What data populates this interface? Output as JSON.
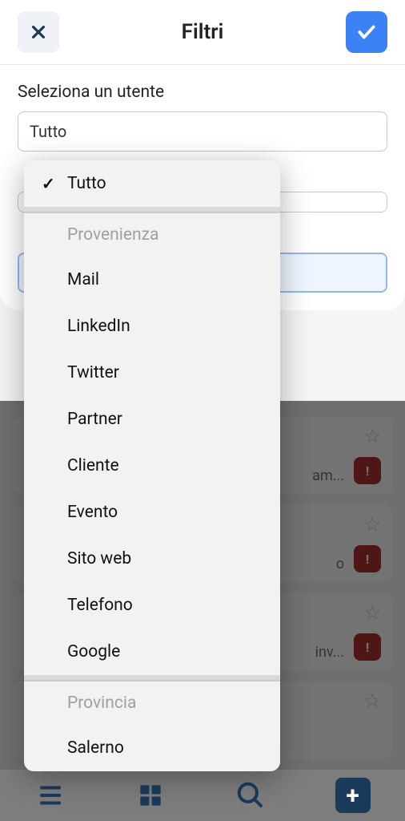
{
  "header": {
    "title": "Filtri"
  },
  "form": {
    "label_user": "Seleziona un utente",
    "value_user": "Tutto"
  },
  "dropdown": {
    "selected": "Tutto",
    "group1_header": "Provenienza",
    "group1_items": [
      "Mail",
      "LinkedIn",
      "Twitter",
      "Partner",
      "Cliente",
      "Evento",
      "Sito web",
      "Telefono",
      "Google"
    ],
    "group2_header": "Provincia",
    "group2_items": [
      "Salerno"
    ]
  },
  "background_list": {
    "rows": [
      {
        "text": "am..."
      },
      {
        "text": "o"
      },
      {
        "text": "inv..."
      },
      {
        "text": ""
      }
    ]
  }
}
